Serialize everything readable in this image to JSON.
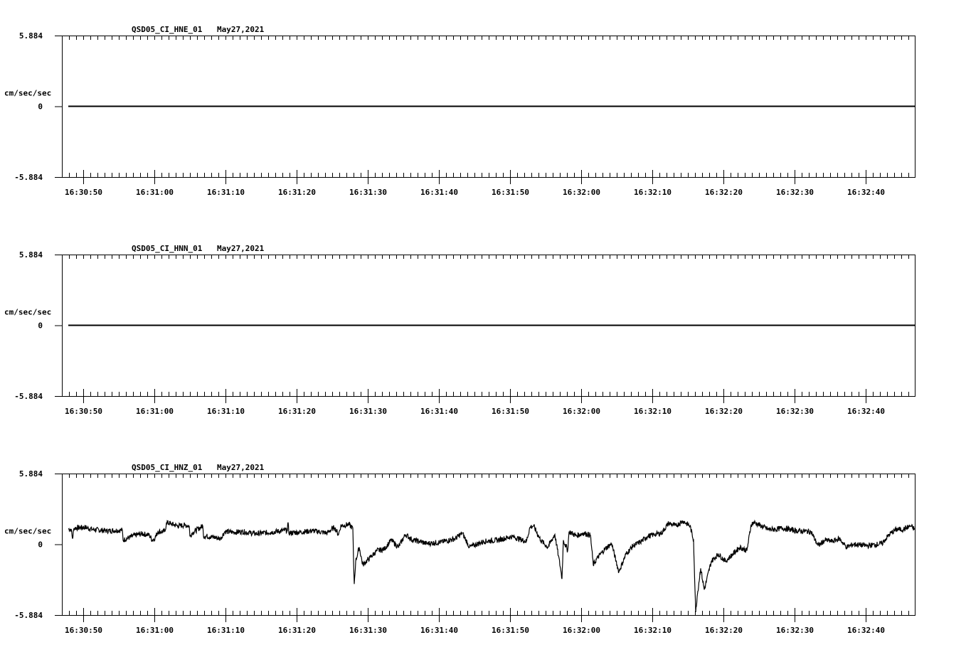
{
  "chart_data": [
    {
      "type": "line",
      "title": "QSD05_CI_HNE_01",
      "date": "May27,2021",
      "ylabel": "cm/sec/sec",
      "ytick_labels": [
        "5.884",
        "0",
        "-5.884"
      ],
      "ylim": [
        -5.884,
        5.884
      ],
      "xlim_seconds_after_16_30_00": [
        47,
        166.9
      ],
      "xtick_labels": [
        "16:30:50",
        "16:31:00",
        "16:31:10",
        "16:31:20",
        "16:31:30",
        "16:31:40",
        "16:31:50",
        "16:32:00",
        "16:32:10",
        "16:32:20",
        "16:32:30",
        "16:32:40"
      ],
      "xtick_seconds": [
        50,
        60,
        70,
        80,
        90,
        100,
        110,
        120,
        130,
        140,
        150,
        160
      ],
      "series": [
        {
          "name": "HNE",
          "x": [
            47.9,
            166.9
          ],
          "y": [
            0,
            0
          ]
        }
      ]
    },
    {
      "type": "line",
      "title": "QSD05_CI_HNN_01",
      "date": "May27,2021",
      "ylabel": "cm/sec/sec",
      "ytick_labels": [
        "5.884",
        "0",
        "-5.884"
      ],
      "ylim": [
        -5.884,
        5.884
      ],
      "xlim_seconds_after_16_30_00": [
        47,
        166.9
      ],
      "xtick_labels": [
        "16:30:50",
        "16:31:00",
        "16:31:10",
        "16:31:20",
        "16:31:30",
        "16:31:40",
        "16:31:50",
        "16:32:00",
        "16:32:10",
        "16:32:20",
        "16:32:30",
        "16:32:40"
      ],
      "xtick_seconds": [
        50,
        60,
        70,
        80,
        90,
        100,
        110,
        120,
        130,
        140,
        150,
        160
      ],
      "series": [
        {
          "name": "HNN",
          "x": [
            47.9,
            166.9
          ],
          "y": [
            0,
            0
          ]
        }
      ]
    },
    {
      "type": "line",
      "title": "QSD05_CI_HNZ_01",
      "date": "May27,2021",
      "ylabel": "cm/sec/sec",
      "ytick_labels": [
        "5.884",
        "0",
        "-5.884"
      ],
      "ylim": [
        -5.884,
        5.884
      ],
      "xlim_seconds_after_16_30_00": [
        47,
        166.9
      ],
      "xtick_labels": [
        "16:30:50",
        "16:31:00",
        "16:31:10",
        "16:31:20",
        "16:31:30",
        "16:31:40",
        "16:31:50",
        "16:32:00",
        "16:32:10",
        "16:32:20",
        "16:32:30",
        "16:32:40"
      ],
      "xtick_seconds": [
        50,
        60,
        70,
        80,
        90,
        100,
        110,
        120,
        130,
        140,
        150,
        160
      ],
      "series": [
        {
          "name": "HNZ",
          "x": [
            47.9,
            48.3,
            48.5,
            48.7,
            50.3,
            51.3,
            53.3,
            55.5,
            55.6,
            57.3,
            58.3,
            59.3,
            59.7,
            60.1,
            60.5,
            61.5,
            61.7,
            62.3,
            63.3,
            64.3,
            64.9,
            65.0,
            65.3,
            66.8,
            66.9,
            68.3,
            69.3,
            69.9,
            71.3,
            72.3,
            74.3,
            76.3,
            78.7,
            78.8,
            78.9,
            80.3,
            82.3,
            84.3,
            85.3,
            85.9,
            86.2,
            87.3,
            87.9,
            88.0,
            88.1,
            88.3,
            88.8,
            89.3,
            90.3,
            91.3,
            92.3,
            93.3,
            94.3,
            95.3,
            96.3,
            97.3,
            98.3,
            100.3,
            102.3,
            103.3,
            104.3,
            106.3,
            108.3,
            110.3,
            112.3,
            112.8,
            113.3,
            114.3,
            115.3,
            116.3,
            116.8,
            117.1,
            117.3,
            117.5,
            118.1,
            118.3,
            119.3,
            120.3,
            121.3,
            121.7,
            122.3,
            123.3,
            124.3,
            124.9,
            125.3,
            126.3,
            127.3,
            128.3,
            129.3,
            130.3,
            131.3,
            132.3,
            133.3,
            134.3,
            135.3,
            135.8,
            136.0,
            136.1,
            136.3,
            136.8,
            137.3,
            138.3,
            139.3,
            140.3,
            141.3,
            142.3,
            143.3,
            143.9,
            144.3,
            145.3,
            146.3,
            147.3,
            148.3,
            149.3,
            150.3,
            152.3,
            153.3,
            154.3,
            155.3,
            156.3,
            157.3,
            158.3,
            160.3,
            162.3,
            163.3,
            164.3,
            165.3,
            166.3,
            166.9
          ],
          "y": [
            1.29,
            1.24,
            0.47,
            1.35,
            1.41,
            1.24,
            1.12,
            1.18,
            0.35,
            0.76,
            0.88,
            0.76,
            0.35,
            0.53,
            1.06,
            1.06,
            1.82,
            1.71,
            1.53,
            1.59,
            1.53,
            0.65,
            0.94,
            1.53,
            0.71,
            0.59,
            0.47,
            1.06,
            1.0,
            1.06,
            0.88,
            1.0,
            1.18,
            1.82,
            0.94,
            1.0,
            1.12,
            0.94,
            1.41,
            0.82,
            1.53,
            1.65,
            1.35,
            -1.41,
            -3.3,
            -1.41,
            -0.24,
            -1.71,
            -1.12,
            -0.53,
            -0.41,
            0.35,
            -0.24,
            0.82,
            0.35,
            0.24,
            0.06,
            0.18,
            0.47,
            0.94,
            -0.24,
            0.24,
            0.35,
            0.65,
            0.24,
            1.41,
            1.53,
            0.35,
            -0.24,
            0.82,
            -0.94,
            -2.0,
            -2.88,
            0.35,
            -0.53,
            1.06,
            0.71,
            0.94,
            0.76,
            -1.71,
            -1.12,
            -0.41,
            0.06,
            -1.41,
            -2.29,
            -0.82,
            -0.12,
            0.18,
            0.65,
            0.82,
            0.94,
            1.76,
            1.53,
            1.94,
            1.53,
            0.35,
            -3.77,
            -5.65,
            -4.35,
            -2.0,
            -3.77,
            -1.41,
            -0.82,
            -1.41,
            -0.82,
            -0.24,
            -0.53,
            1.65,
            1.82,
            1.53,
            1.24,
            1.24,
            1.35,
            1.24,
            1.12,
            1.06,
            -0.12,
            0.35,
            0.24,
            0.47,
            -0.24,
            0.0,
            -0.12,
            0.06,
            0.82,
            1.24,
            1.24,
            1.53,
            1.24
          ]
        }
      ]
    }
  ]
}
